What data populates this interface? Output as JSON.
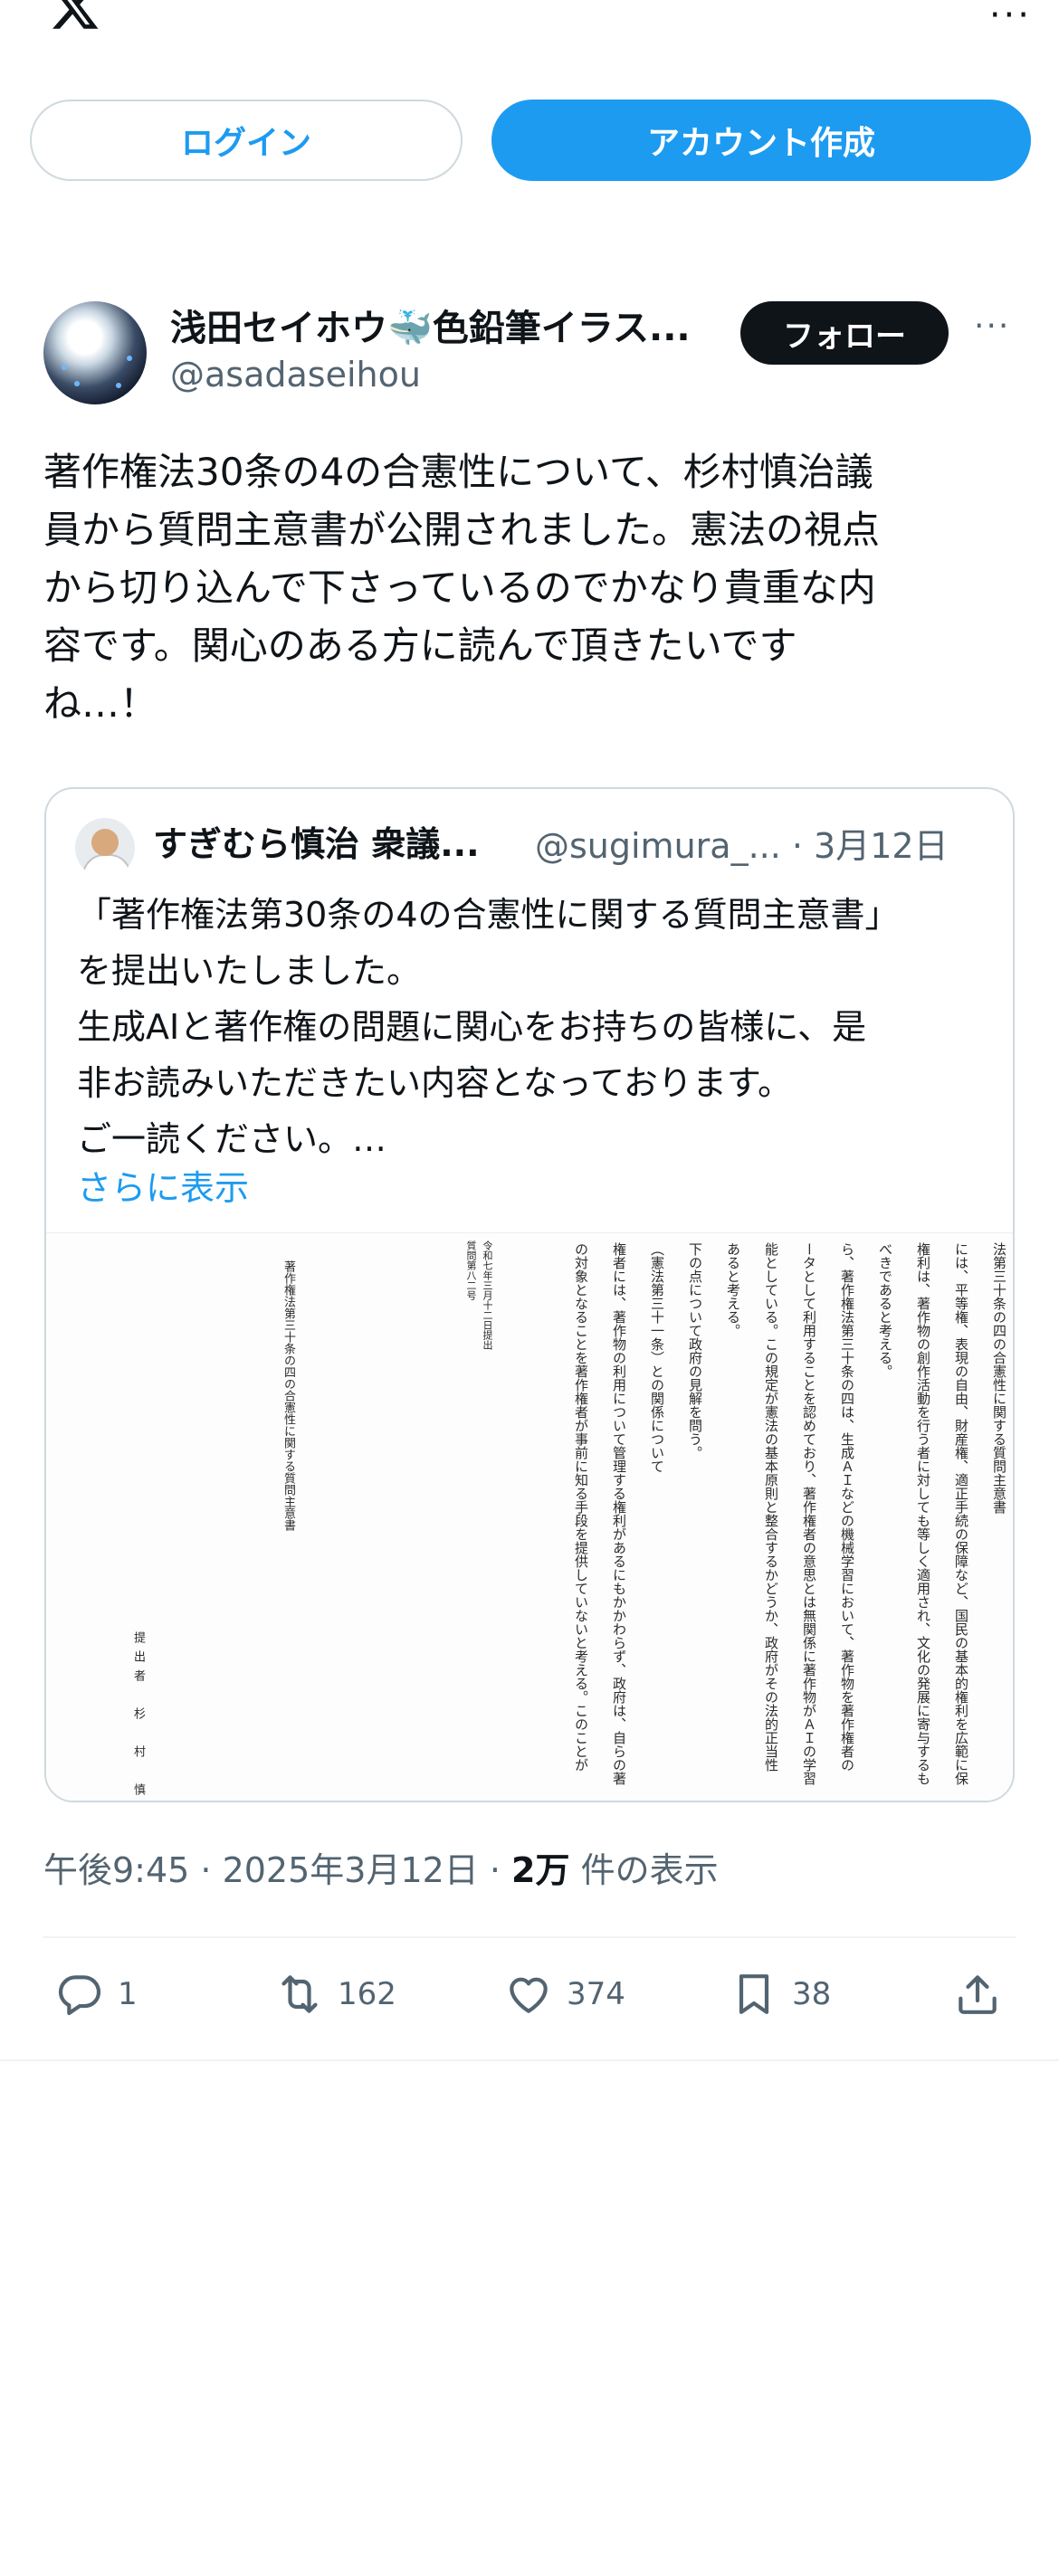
{
  "topbar": {
    "more_label": "···"
  },
  "auth": {
    "login_label": "ログイン",
    "signup_label": "アカウント作成"
  },
  "post": {
    "author_name": "浅田セイホウ🐳色鉛筆イラス...",
    "author_handle": "@asadaseihou",
    "follow_label": "フォロー",
    "more_label": "···",
    "text": "著作権法30条の4の合憲性について、杉村慎治議\n員から質問主意書が公開されました。憲法の視点\nから切り込んで下さっているのでかなり貴重な内\n容です。関心のある方に読んで頂きたいです\nね…！"
  },
  "quote": {
    "author_name": "すぎむら慎治 衆議...",
    "author_handle": "@sugimura_... · 3月12日",
    "text": "「著作権法第30条の4の合憲性に関する質問主意書」\nを提出いたしました。\n生成AIと著作権の問題に関心をお持ちの皆様に、是\n非お読みいただきたい内容となっております。\nご一読ください。…",
    "show_more": "さらに表示",
    "document": {
      "date_line": "令和七年三月十二日提出",
      "number_line": "質問第八二号",
      "title": "著作権法第三十条の四の合憲性に関する質問主意書",
      "submitter": "提出者　杉　村　慎",
      "body_cols": [
        "法第三十条の四の合憲性に関する質問主意書",
        "には、平等権、表現の自由、財産権、適正手続の保障など、国民の基本的権利を広範に保",
        "権利は、著作物の創作活動を行う者に対しても等しく適用され、文化の発展に寄与するも",
        "べきであると考える。",
        "ら、著作権法第三十条の四は、生成ＡＩなどの機械学習において、著作物を著作権者の",
        "ータとして利用することを認めており、著作権者の意思とは無関係に著作物がＡＩの学習",
        "能としている。この規定が憲法の基本原則と整合するかどうか、政府がその法的正当性",
        "あると考える。",
        "下の点について政府の見解を問う。",
        "（憲法第三十一条）との関係について",
        "権者には、著作物の利用について管理する権利があるにもかかわらず、政府は、自らの著",
        "の対象となることを著作権者が事前に知る手段を提供していないと考える。このことが"
      ]
    }
  },
  "meta": {
    "time": "午後9:45 · 2025年3月12日 · ",
    "views": "2万",
    "views_suffix": " 件の表示"
  },
  "actions": {
    "replies": "1",
    "reposts": "162",
    "likes": "374",
    "bookmarks": "38"
  },
  "colors": {
    "accent": "#1d9bf0",
    "text": "#0f1419",
    "secondary": "#536471",
    "border": "#cfd9de"
  }
}
